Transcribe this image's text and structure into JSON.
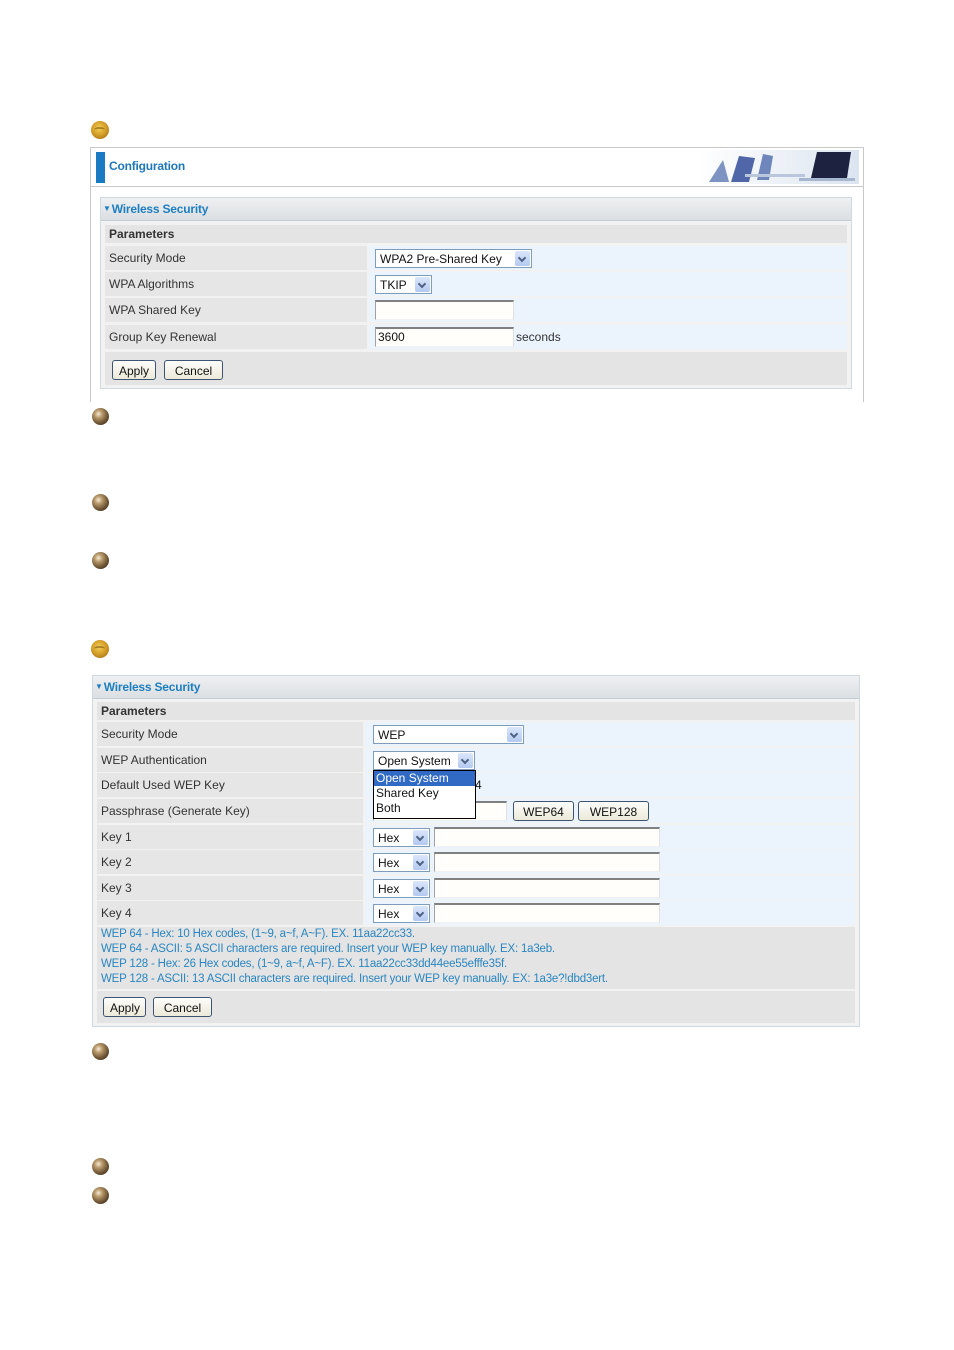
{
  "config_header": {
    "title": "Configuration"
  },
  "panel1": {
    "title": "Wireless Security",
    "params_label": "Parameters",
    "rows": [
      {
        "label": "Security Mode",
        "control": "select",
        "value": "WPA2 Pre-Shared Key"
      },
      {
        "label": "WPA Algorithms",
        "control": "select",
        "value": "TKIP"
      },
      {
        "label": "WPA Shared Key",
        "control": "text",
        "value": ""
      },
      {
        "label": "Group Key Renewal",
        "control": "text",
        "value": "3600",
        "suffix": "seconds"
      }
    ],
    "apply_label": "Apply",
    "cancel_label": "Cancel"
  },
  "panel2": {
    "title": "Wireless Security",
    "params_label": "Parameters",
    "rows": [
      {
        "label": "Security Mode",
        "control": "select",
        "value": "WEP"
      },
      {
        "label": "WEP Authentication",
        "control": "select",
        "value": "Open System"
      },
      {
        "label": "Default Used WEP Key",
        "control": "select",
        "value": "4",
        "visible_fragment": "4"
      },
      {
        "label": "Passphrase (Generate Key)",
        "control": "text",
        "value": ""
      },
      {
        "label": "Key 1",
        "control": "select+text",
        "format": "Hex",
        "value": ""
      },
      {
        "label": "Key 2",
        "control": "select+text",
        "format": "Hex",
        "value": ""
      },
      {
        "label": "Key 3",
        "control": "select+text",
        "format": "Hex",
        "value": ""
      },
      {
        "label": "Key 4",
        "control": "select+text",
        "format": "Hex",
        "value": ""
      }
    ],
    "wep64_label": "WEP64",
    "wep128_label": "WEP128",
    "auth_dropdown": {
      "options": [
        "Open System",
        "Shared Key",
        "Both"
      ],
      "highlighted": "Open System"
    },
    "hints": [
      "WEP 64 - Hex: 10 Hex codes, (1~9, a~f, A~F). EX. 11aa22cc33.",
      "WEP 64 - ASCII: 5 ASCII characters are required. Insert your WEP key manually. EX: 1a3eb.",
      "WEP 128 - Hex: 26 Hex codes, (1~9, a~f, A~F). EX. 11aa22cc33dd44ee55efffe35f.",
      "WEP 128 - ASCII: 13 ASCII characters are required. Insert your WEP key manually. EX: 1a3e?!dbd3ert."
    ],
    "apply_label": "Apply",
    "cancel_label": "Cancel"
  },
  "icons": {
    "section_bullet": "gold-globe-bullet-icon",
    "item_bullet": "bronze-ball-bullet-icon"
  },
  "colors": {
    "accent_blue": "#1a7ac2",
    "title_blue": "#1e7fc0",
    "hint_blue": "#2a86c0",
    "label_bg": "#e6e6e6",
    "value_bg": "#ebf4fd",
    "dropdown_highlight": "#316ac5"
  }
}
